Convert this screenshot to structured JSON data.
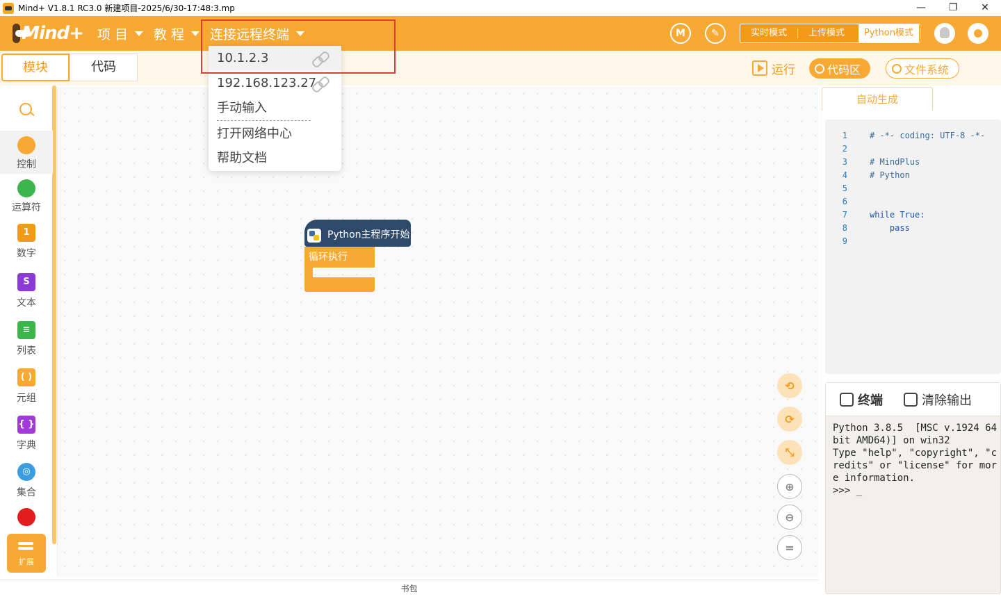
{
  "window": {
    "title": "Mind+ V1.8.1 RC3.0   新建项目-2025/6/30-17:48:3.mp",
    "min": "—",
    "max": "❐",
    "close": "✕"
  },
  "header": {
    "logo_text": "Mind+",
    "menus": [
      {
        "label": "项 目"
      },
      {
        "label": "教 程"
      },
      {
        "label": "连接远程终端"
      }
    ],
    "icon1": "M",
    "icon2": "✎",
    "modes": [
      {
        "label": "实时模式"
      },
      {
        "label": "上传模式"
      },
      {
        "label": "Python模式"
      }
    ]
  },
  "subbar": {
    "tabs": [
      {
        "label": "模块"
      },
      {
        "label": "代码"
      }
    ],
    "run_label": "运行",
    "code_label": "代码区",
    "fs_label": "文件系统"
  },
  "palette": {
    "categories": [
      {
        "label": "控制",
        "color": "#f7a933"
      },
      {
        "label": "运算符",
        "color": "#3cb54a"
      },
      {
        "label": "数字",
        "color": "#f39a1a",
        "glyph": "1"
      },
      {
        "label": "文本",
        "color": "#8b3ad8",
        "glyph": "S"
      },
      {
        "label": "列表",
        "color": "#3cb54a",
        "glyph": "≡"
      },
      {
        "label": "元组",
        "color": "#f7a933",
        "glyph": "( )"
      },
      {
        "label": "字典",
        "color": "#a23ad8",
        "glyph": "{ }"
      },
      {
        "label": "集合",
        "color": "#3b9de0",
        "glyph": "◎"
      }
    ],
    "extra_dot_color": "#e31d1d",
    "ext_label": "扩展"
  },
  "workspace": {
    "hat_block": "Python主程序开始",
    "loop_block": "循环执行",
    "bag_label": "书包",
    "controls": [
      "⟲",
      "⟳",
      "⤡",
      "⊕",
      "⊖",
      "="
    ]
  },
  "code_panel": {
    "tab_label": "自动生成",
    "lines": [
      {
        "n": "1",
        "t": "# -*- coding: UTF-8 -*-",
        "c": "comment"
      },
      {
        "n": "2",
        "t": "",
        "c": ""
      },
      {
        "n": "3",
        "t": "# MindPlus",
        "c": "comment"
      },
      {
        "n": "4",
        "t": "# Python",
        "c": "comment"
      },
      {
        "n": "5",
        "t": "",
        "c": ""
      },
      {
        "n": "6",
        "t": "",
        "c": ""
      },
      {
        "n": "7",
        "t": "while True:",
        "c": "kw"
      },
      {
        "n": "8",
        "t": "    pass",
        "c": "kw"
      },
      {
        "n": "9",
        "t": "",
        "c": ""
      }
    ]
  },
  "terminal": {
    "terminal_label": "终端",
    "clear_label": "清除输出",
    "output": "Python 3.8.5  [MSC v.1924 64 bit AMD64)] on win32\nType \"help\", \"copyright\", \"credits\" or \"license\" for more information.\n>>> _"
  },
  "dropdown": {
    "items": [
      {
        "label": "10.1.2.3",
        "link": true
      },
      {
        "label": "192.168.123.27",
        "link": true
      },
      {
        "label": "手动输入",
        "link": false
      },
      {
        "label": "打开网络中心",
        "link": false
      },
      {
        "label": "帮助文档",
        "link": false
      }
    ]
  }
}
